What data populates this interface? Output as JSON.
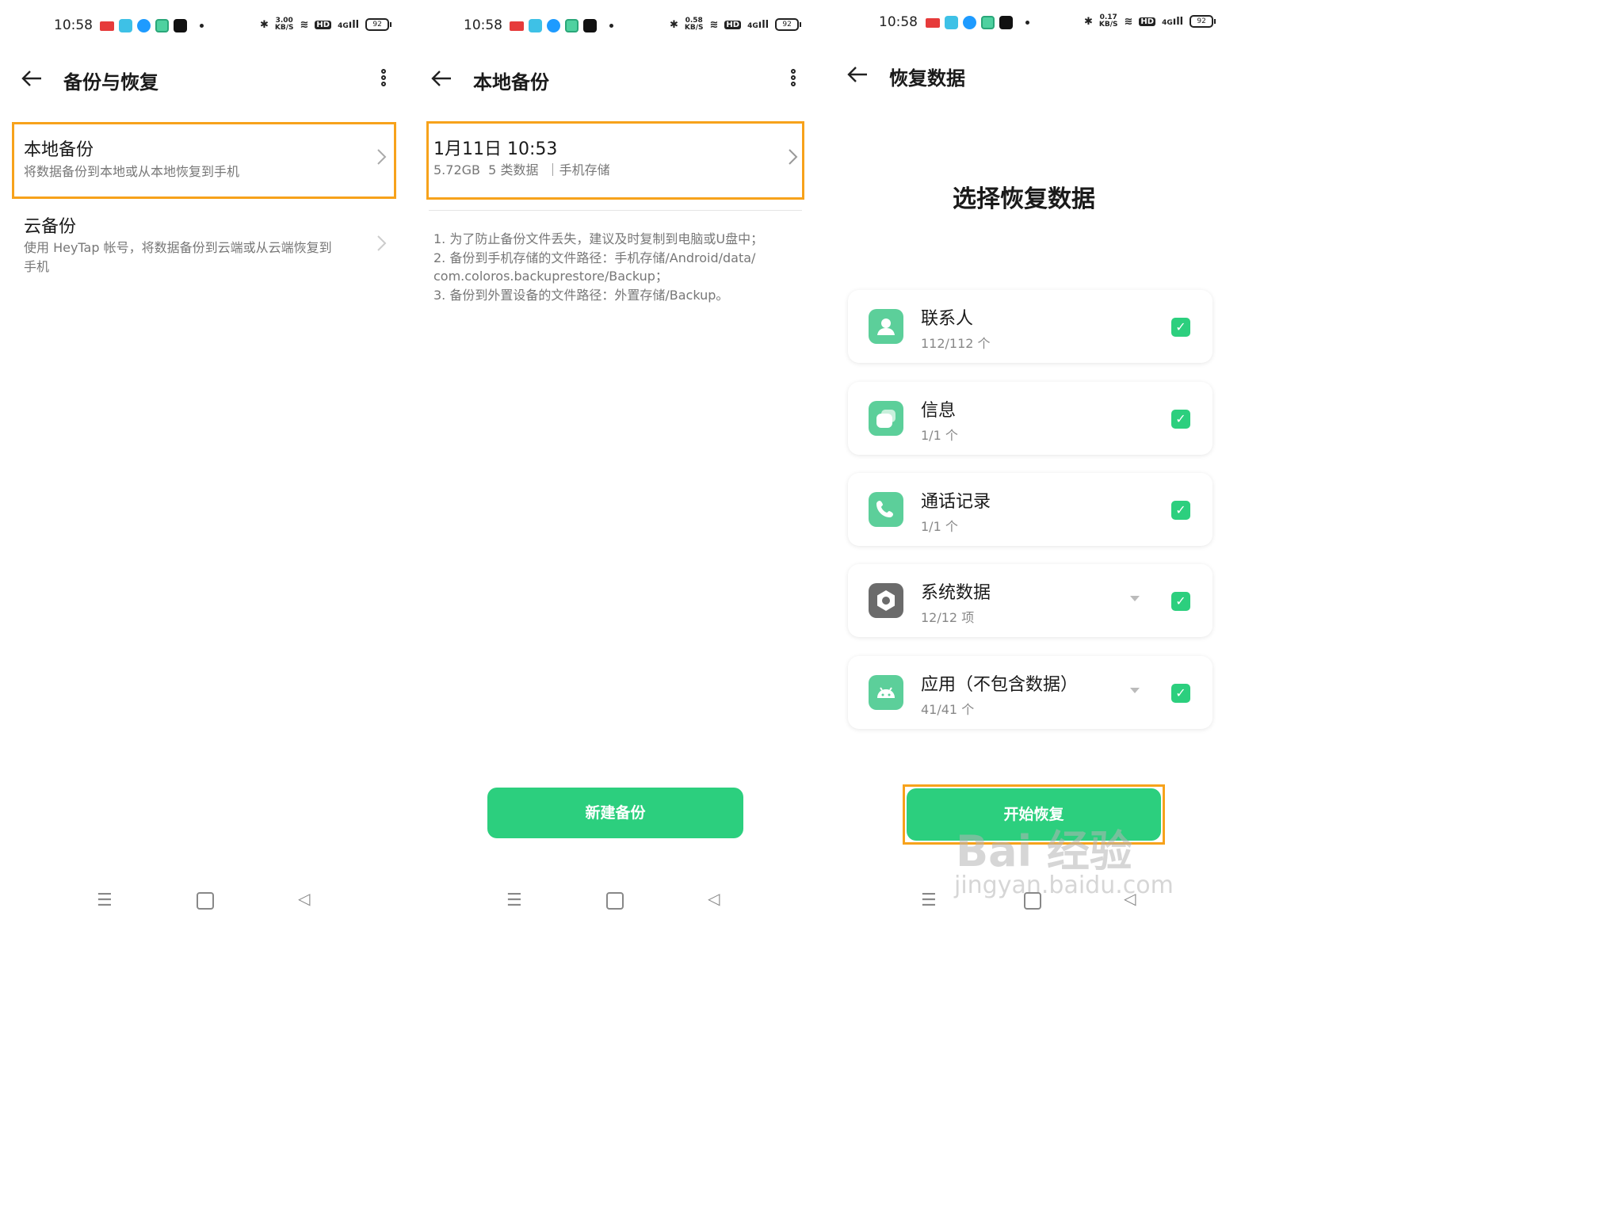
{
  "status": {
    "time": "10:58",
    "app_badge": "头条",
    "speeds": [
      "3.00",
      "0.58",
      "0.17"
    ],
    "speed_unit": "KB/S",
    "hd": "HD",
    "net": "4G",
    "battery": "92"
  },
  "panel1": {
    "title": "备份与恢复",
    "local": {
      "title": "本地备份",
      "subtitle": "将数据备份到本地或从本地恢复到手机"
    },
    "cloud": {
      "title": "云备份",
      "subtitle_line1": "使用 HeyTap 帐号，将数据备份到云端或从云端恢复到",
      "subtitle_line2": "手机"
    }
  },
  "panel2": {
    "title": "本地备份",
    "backup": {
      "datetime": "1月11日 10:53",
      "meta": "5.72GB  5 类数据  ｜手机存储"
    },
    "notes": [
      "1. 为了防止备份文件丢失，建议及时复制到电脑或U盘中；",
      "2. 备份到手机存储的文件路径：手机存储/Android/data/",
      "com.coloros.backuprestore/Backup；",
      "3. 备份到外置设备的文件路径：外置存储/Backup。"
    ],
    "button": "新建备份"
  },
  "panel3": {
    "title": "恢复数据",
    "heading": "选择恢复数据",
    "items": [
      {
        "label": "联系人",
        "count": "112/112 个",
        "icon": "contacts-icon"
      },
      {
        "label": "信息",
        "count": "1/1 个",
        "icon": "messages-icon"
      },
      {
        "label": "通话记录",
        "count": "1/1 个",
        "icon": "phone-icon"
      },
      {
        "label": "系统数据",
        "count": "12/12 项",
        "icon": "settings-icon"
      },
      {
        "label": "应用（不包含数据）",
        "count": "41/41 个",
        "icon": "android-icon"
      }
    ],
    "button": "开始恢复"
  },
  "watermark": {
    "logo": "Bai 经验",
    "url": "jingyan.baidu.com"
  },
  "colors": {
    "accent": "#2ccf7e",
    "highlight": "#f7a21b",
    "icon_green": "#5ccf9a"
  }
}
